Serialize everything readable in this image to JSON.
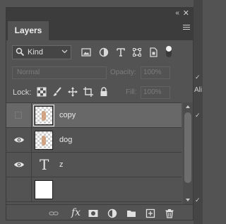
{
  "panel": {
    "collapse_glyph": "‹‹",
    "close_glyph": "✕",
    "tab_label": "Layers"
  },
  "filter": {
    "kind_label": "Kind",
    "icons": [
      "pixel-filter-icon",
      "adjustment-filter-icon",
      "type-filter-icon",
      "shape-filter-icon",
      "smart-object-filter-icon",
      "filter-toggle"
    ]
  },
  "blend": {
    "mode": "Normal",
    "opacity_label": "Opacity:",
    "opacity_value": "100%"
  },
  "lock": {
    "label": "Lock:",
    "fill_label": "Fill:",
    "fill_value": "100%"
  },
  "layers": [
    {
      "name": "copy",
      "visible": false,
      "selected": true,
      "thumb": "raster"
    },
    {
      "name": "dog",
      "visible": true,
      "selected": false,
      "thumb": "raster"
    },
    {
      "name": "z",
      "visible": true,
      "selected": false,
      "thumb": "type"
    },
    {
      "name": "",
      "visible": false,
      "selected": false,
      "thumb": "white"
    }
  ],
  "type_thumb_glyph": "T",
  "bottom_icons": [
    "link-layers-icon",
    "fx-icon",
    "add-mask-icon",
    "adjustment-layer-icon",
    "new-group-icon",
    "new-layer-icon",
    "delete-layer-icon"
  ],
  "fx_label": "fx",
  "right_panel": {
    "partial_label": "Ali",
    "check_glyph": "✓"
  }
}
